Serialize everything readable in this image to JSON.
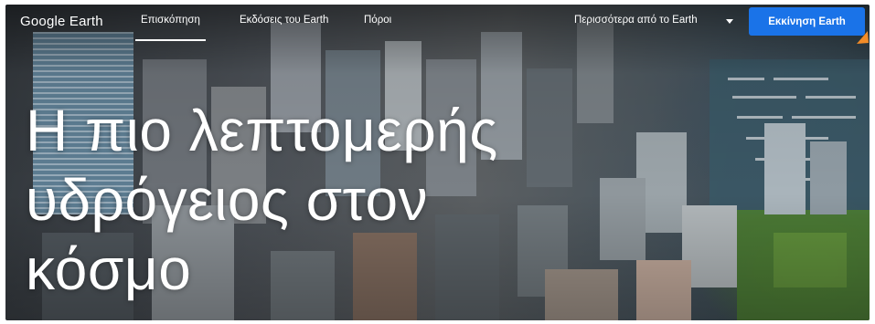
{
  "nav": {
    "logo": "Google Earth",
    "links": [
      "Επισκόπηση",
      "Εκδόσεις του Earth",
      "Πόροι"
    ],
    "more_label": "Περισσότερα από το Earth",
    "launch_label": "Εκκίνηση Earth"
  },
  "hero": {
    "lines": [
      "Η πιο λεπτομερής",
      "υδρόγειος στον",
      "κόσμο"
    ]
  },
  "colors": {
    "accent": "#1a73e8",
    "cursor": "#f28c28"
  },
  "icons": [
    "chevron-down-icon",
    "cursor-arrow-icon"
  ]
}
